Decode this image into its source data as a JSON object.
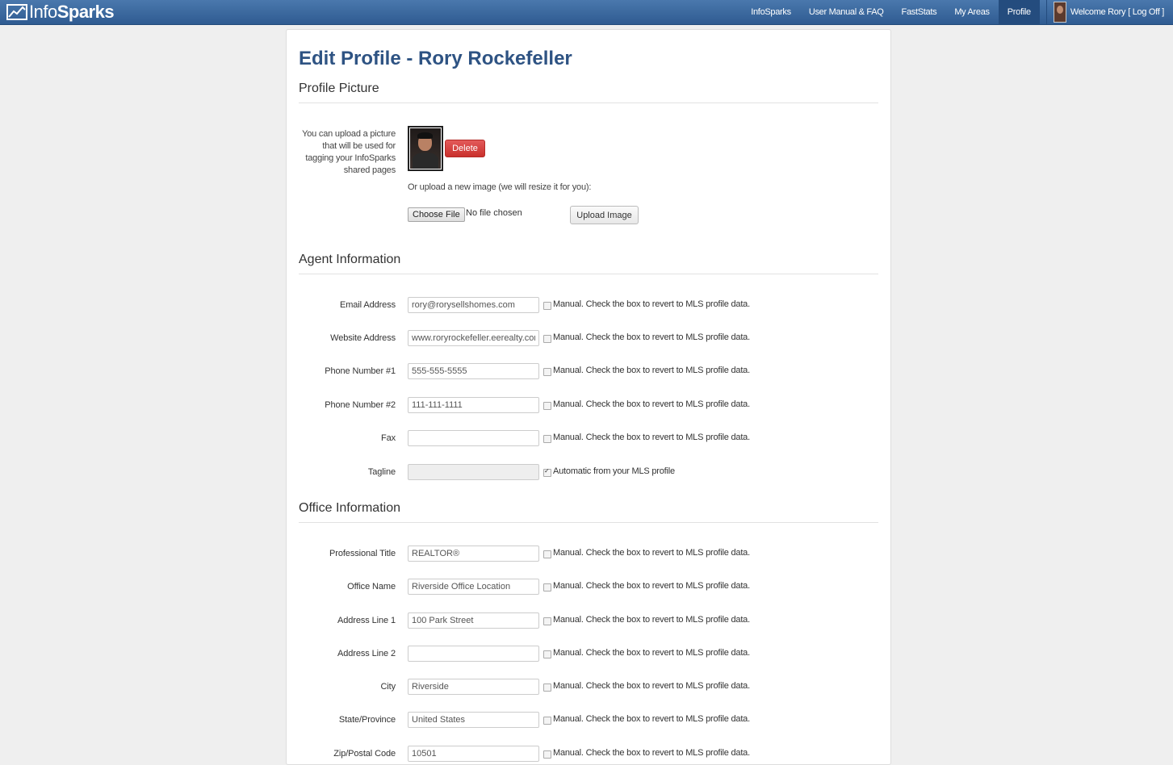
{
  "brand": {
    "name_part1": "Info",
    "name_part2": "Sparks"
  },
  "nav": {
    "items": [
      "InfoSparks",
      "User Manual & FAQ",
      "FastStats",
      "My Areas",
      "Profile"
    ],
    "active": "Profile",
    "welcome": "Welcome Rory",
    "logoff": "[ Log Off ]"
  },
  "page": {
    "title": "Edit Profile - Rory Rockefeller"
  },
  "profile_picture": {
    "heading": "Profile Picture",
    "description": "You can upload a picture that will be used for tagging your InfoSparks shared pages",
    "delete_label": "Delete",
    "upload_hint": "Or upload a new image (we will resize it for you):",
    "choose_file_label": "Choose File",
    "no_file_text": "No file chosen",
    "upload_label": "Upload Image"
  },
  "agent_information": {
    "heading": "Agent Information",
    "fields": [
      {
        "label": "Email Address",
        "value": "rory@rorysellshomes.com",
        "note": "Manual. Check the box to revert to MLS profile data.",
        "checked": false,
        "disabled": false
      },
      {
        "label": "Website Address",
        "value": "www.roryrockefeller.eerealty.com",
        "note": "Manual. Check the box to revert to MLS profile data.",
        "checked": false,
        "disabled": false
      },
      {
        "label": "Phone Number #1",
        "value": "555-555-5555",
        "note": "Manual. Check the box to revert to MLS profile data.",
        "checked": false,
        "disabled": false
      },
      {
        "label": "Phone Number #2",
        "value": "111-111-1111",
        "note": "Manual. Check the box to revert to MLS profile data.",
        "checked": false,
        "disabled": false
      },
      {
        "label": "Fax",
        "value": "",
        "note": "Manual. Check the box to revert to MLS profile data.",
        "checked": false,
        "disabled": false
      },
      {
        "label": "Tagline",
        "value": "",
        "note": "Automatic from your MLS profile",
        "checked": true,
        "disabled": true
      }
    ]
  },
  "office_information": {
    "heading": "Office Information",
    "fields": [
      {
        "label": "Professional Title",
        "value": "REALTOR®",
        "note": "Manual. Check the box to revert to MLS profile data.",
        "checked": false,
        "disabled": false
      },
      {
        "label": "Office Name",
        "value": "Riverside Office Location",
        "note": "Manual. Check the box to revert to MLS profile data.",
        "checked": false,
        "disabled": false
      },
      {
        "label": "Address Line 1",
        "value": "100 Park Street",
        "note": "Manual. Check the box to revert to MLS profile data.",
        "checked": false,
        "disabled": false
      },
      {
        "label": "Address Line 2",
        "value": "",
        "note": "Manual. Check the box to revert to MLS profile data.",
        "checked": false,
        "disabled": false
      },
      {
        "label": "City",
        "value": "Riverside",
        "note": "Manual. Check the box to revert to MLS profile data.",
        "checked": false,
        "disabled": false
      },
      {
        "label": "State/Province",
        "value": "United States",
        "note": "Manual. Check the box to revert to MLS profile data.",
        "checked": false,
        "disabled": false
      },
      {
        "label": "Zip/Postal Code",
        "value": "10501",
        "note": "Manual. Check the box to revert to MLS profile data.",
        "checked": false,
        "disabled": false
      }
    ]
  },
  "colors": {
    "navbar": "#3a67a0",
    "title": "#2e5383",
    "delete": "#d9534f"
  }
}
